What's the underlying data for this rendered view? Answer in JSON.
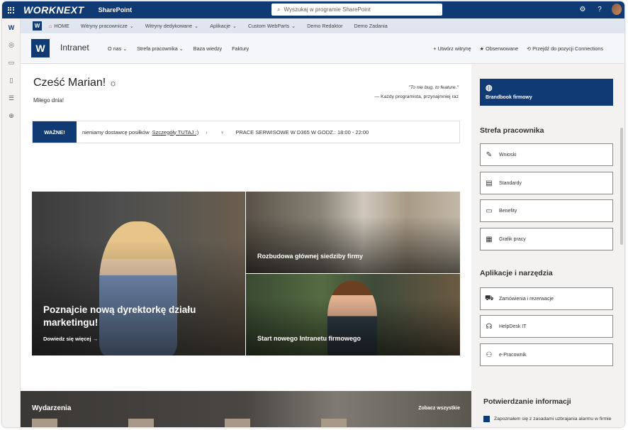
{
  "suite": {
    "brand": "WORKNEXT",
    "app": "SharePoint",
    "search_placeholder": "Wyszukaj w programie SharePoint"
  },
  "hub": {
    "logo": "W",
    "items": [
      "HOME",
      "Witryny pracownicze",
      "Witryny dedykowane",
      "Aplikacje",
      "Custom WebParts",
      "Demo Redaktor",
      "Demo Zadania"
    ]
  },
  "site": {
    "logo": "W",
    "title": "Intranet",
    "nav": [
      "O nas",
      "Strefa pracownika",
      "Baza wiedzy",
      "Faktury"
    ],
    "actions": {
      "create": "Utwórz witrynę",
      "follow": "Obserwowane",
      "connections": "Przejdź do pozycji Connections"
    }
  },
  "greeting": {
    "title": "Cześć Marian!",
    "subtitle": "Miłego dnia!",
    "quote": "\"To nie bug, to feature.\"",
    "author": "— Każdy programista, przynajmniej raz"
  },
  "ticker": {
    "label": "WAŻNE!",
    "message": "nieniamy dostawcę posiłków",
    "link": "Szczegóły TUTAJ :)",
    "message2": "PRACE SERWISOWE W D365 W GODZ.: 18:00 - 22:00"
  },
  "hero": {
    "main": {
      "title": "Poznajcie nową dyrektorkę działu marketingu!",
      "more": "Dowiedz się więcej →"
    },
    "top": {
      "title": "Rozbudowa głównej siedziby firmy"
    },
    "bottom": {
      "title": "Start nowego Intranetu firmowego"
    }
  },
  "events": {
    "title": "Wydarzenia",
    "all": "Zobacz wszystkie"
  },
  "sidebar": {
    "brandbook": "Brandbook firmowy",
    "strefa_title": "Strefa pracownika",
    "strefa": [
      "Wnioski",
      "Standardy",
      "Benefity",
      "Grafik pracy"
    ],
    "apps_title": "Aplikacje i narzędzia",
    "apps": [
      "Zamówienia i rezerwacje",
      "HelpDesk IT",
      "e-Pracownik"
    ],
    "confirm_title": "Potwierdzanie informacji",
    "confirm_text": "Zapoznałem się z zasadami uzbrajania alarmu w firmie"
  }
}
